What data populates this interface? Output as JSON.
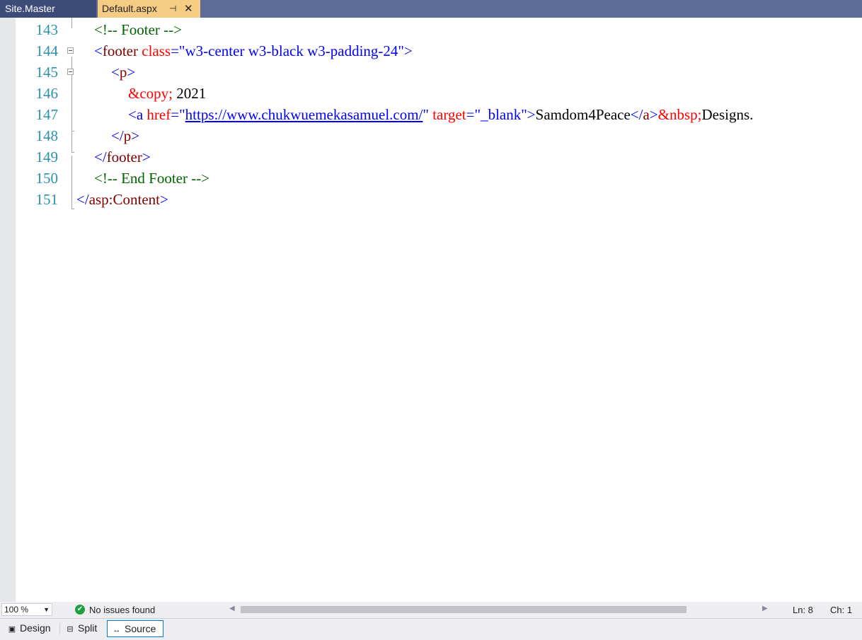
{
  "tabs": [
    {
      "label": "Site.Master",
      "active": false
    },
    {
      "label": "Default.aspx",
      "active": true,
      "pin_icon": "pin-icon",
      "close_icon": "close-icon"
    }
  ],
  "editor": {
    "lines": [
      {
        "number": "143",
        "tokens": [
          "<!-- Footer -->"
        ]
      },
      {
        "number": "144",
        "tokens": [
          "<",
          "footer",
          " ",
          "class",
          "=\"",
          "w3-center w3-black w3-padding-24",
          "\">"
        ]
      },
      {
        "number": "145",
        "tokens": [
          "<",
          "p",
          ">"
        ]
      },
      {
        "number": "146",
        "tokens": [
          "&copy;",
          " 2021"
        ]
      },
      {
        "number": "147",
        "tokens": [
          "<a ",
          "href",
          "=\"",
          "https://www.chukwuemekasamuel.com/",
          "\" ",
          "target",
          "=\"",
          "_blank",
          "\">",
          "Samdom4Peace",
          "</",
          "a",
          ">",
          "&nbsp;",
          "Designs."
        ]
      },
      {
        "number": "148",
        "tokens": [
          "</",
          "p",
          ">"
        ]
      },
      {
        "number": "149",
        "tokens": [
          "</",
          "footer",
          ">"
        ]
      },
      {
        "number": "150",
        "tokens": [
          "<!-- End Footer -->"
        ]
      },
      {
        "number": "151",
        "tokens": [
          "</",
          "asp:Content",
          ">"
        ]
      }
    ]
  },
  "status": {
    "zoom": "100 %",
    "issues_icon": "check-circle-icon",
    "issues": "No issues found",
    "line": "Ln: 8",
    "char": "Ch: 1"
  },
  "views": [
    {
      "label": "Design",
      "icon": "design-view-icon"
    },
    {
      "label": "Split",
      "icon": "split-view-icon"
    },
    {
      "label": "Source",
      "icon": "source-view-icon",
      "selected": true
    }
  ],
  "colors": {
    "tab_strip": "#5d6b99",
    "active_tab": "#f5cc84",
    "line_number": "#2b91af",
    "tag_name": "#800000",
    "attribute": "#ff0000",
    "attribute_value": "#0000ff",
    "comment": "#006400"
  }
}
